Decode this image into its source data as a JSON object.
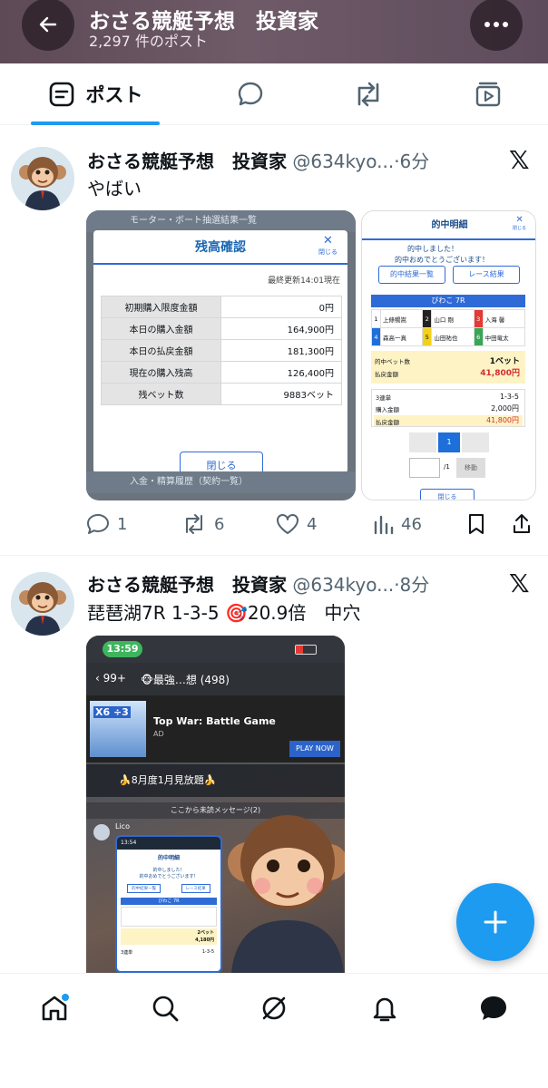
{
  "header": {
    "title": "おさる競艇予想　投資家",
    "post_count": "2,297 件のポスト"
  },
  "tabs": [
    {
      "label": "ポスト",
      "icon": "post-icon",
      "active": true
    },
    {
      "label": "",
      "icon": "reply-icon"
    },
    {
      "label": "",
      "icon": "repost-icon"
    },
    {
      "label": "",
      "icon": "media-icon"
    }
  ],
  "posts": [
    {
      "name": "おさる競艇予想　投資家",
      "handle": "@634kyo...",
      "time": "·6分",
      "text": "やばい",
      "actions": {
        "replies": "1",
        "reposts": "6",
        "likes": "4",
        "views": "46"
      },
      "media_balance": {
        "top_strip": "モーター・ボート抽選結果一覧",
        "title": "残高確認",
        "close_x": "✕",
        "close_small": "閉じる",
        "updated": "最終更新14:01現在",
        "rows": [
          {
            "label": "初期購入限度金額",
            "value": "0円"
          },
          {
            "label": "本日の購入金額",
            "value": "164,900円"
          },
          {
            "label": "本日の払戻金額",
            "value": "181,300円"
          },
          {
            "label": "現在の購入残高",
            "value": "126,400円"
          },
          {
            "label": "残ベット数",
            "value": "9883ベット"
          }
        ],
        "close_button": "閉じる",
        "bottom_strip": "入金・精算履歴（契約一覧）"
      },
      "media_result": {
        "title": "的中明細",
        "close_x": "✕",
        "close_small": "閉じる",
        "congrats_1": "的中しました！",
        "congrats_2": "的中おめでとうございます！",
        "btn_list": "的中結果一覧",
        "btn_race": "レース結果",
        "race": "びわこ 7R",
        "racers": [
          {
            "num": "1",
            "name": "上條暢嵩",
            "color": "#ffffff",
            "text": "#000"
          },
          {
            "num": "2",
            "name": "山口 剛",
            "color": "#222222",
            "text": "#fff"
          },
          {
            "num": "3",
            "name": "入海 馨",
            "color": "#e53935",
            "text": "#fff"
          },
          {
            "num": "4",
            "name": "森高一真",
            "color": "#1e6fd9",
            "text": "#fff"
          },
          {
            "num": "5",
            "name": "山田祐也",
            "color": "#f3d11b",
            "text": "#000"
          },
          {
            "num": "6",
            "name": "中田竜太",
            "color": "#3aa655",
            "text": "#fff"
          }
        ],
        "bet_label": "的中ベット数",
        "bet_value": "1ベット",
        "payout_label": "払戻金額",
        "payout_value": "41,800円",
        "type": "3連単",
        "combo": "1-3-5",
        "buy_label": "購入金額",
        "buy_value": "2,000円",
        "refund_label": "払戻金額",
        "refund_value": "41,800円",
        "page": "1",
        "page_total": "/1",
        "move": "移動",
        "close_button": "閉じる"
      }
    },
    {
      "name": "おさる競艇予想　投資家",
      "handle": "@634kyo...",
      "time": "·8分",
      "text": "琵琶湖7R 1-3-5 🎯20.9倍　中穴",
      "media_chat": {
        "time": "13:59",
        "back_count": "99+",
        "group": "🐵最強…想 (498)",
        "ad_title": "Top War: Battle Game",
        "ad_label": "AD",
        "ad_cta": "PLAY NOW",
        "ad_badge": "X6 ÷3",
        "banner": "🍌8月度1月見放題🍌",
        "unread": "ここから未読メッセージ(2)",
        "sender": "Lico",
        "inner_title": "的中明細",
        "inner_congrats_1": "的中しました！",
        "inner_congrats_2": "的中おめでとうございます！",
        "inner_btn_list": "的中結果一覧",
        "inner_btn_race": "レース結果",
        "inner_race": "びわこ 7R",
        "inner_bet_value": "2ベット",
        "inner_payout": "4,180円",
        "inner_type": "3連単",
        "inner_combo": "1-3-5"
      }
    }
  ],
  "nav": [
    "home-icon",
    "search-icon",
    "grok-icon",
    "notifications-icon",
    "messages-icon"
  ],
  "colors": {
    "accent": "#1d9bf0",
    "header_bg": "#6a5664",
    "muted": "#536471"
  }
}
